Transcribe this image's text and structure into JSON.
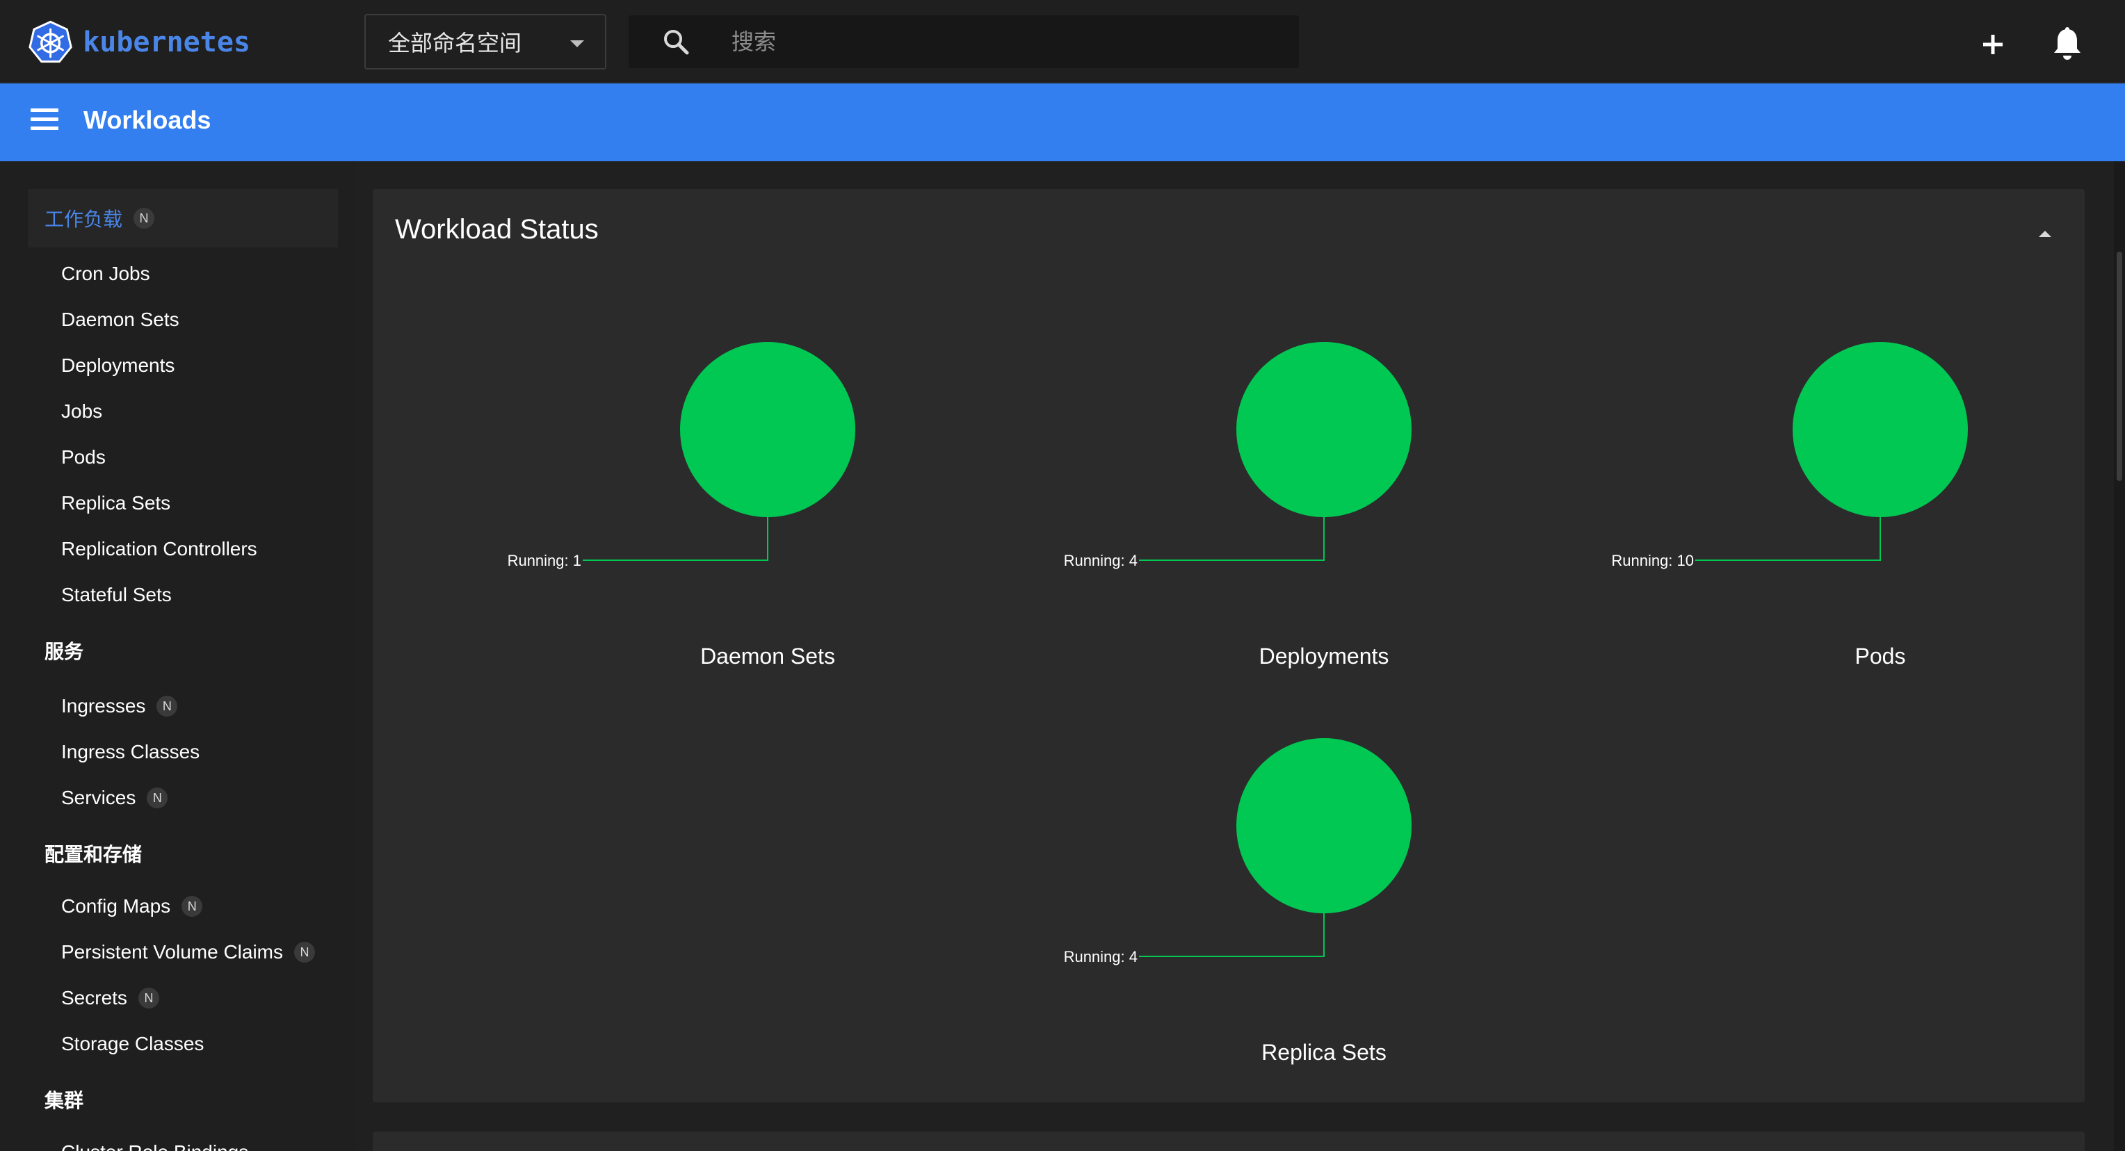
{
  "topbar": {
    "logo_text": "kubernetes",
    "namespace_selected": "全部命名空间",
    "search_placeholder": "搜索",
    "icons": [
      "kubernetes-logo",
      "chevron-down-icon",
      "search-icon",
      "plus-icon",
      "bell-icon"
    ]
  },
  "header": {
    "title": "Workloads"
  },
  "sidebar": {
    "sections": [
      {
        "label": "工作负载",
        "badge": "N",
        "active": true,
        "items": [
          {
            "label": "Cron Jobs"
          },
          {
            "label": "Daemon Sets"
          },
          {
            "label": "Deployments"
          },
          {
            "label": "Jobs"
          },
          {
            "label": "Pods"
          },
          {
            "label": "Replica Sets"
          },
          {
            "label": "Replication Controllers"
          },
          {
            "label": "Stateful Sets"
          }
        ]
      },
      {
        "label": "服务",
        "items": [
          {
            "label": "Ingresses",
            "badge": "N"
          },
          {
            "label": "Ingress Classes"
          },
          {
            "label": "Services",
            "badge": "N"
          }
        ]
      },
      {
        "label": "配置和存储",
        "items": [
          {
            "label": "Config Maps",
            "badge": "N"
          },
          {
            "label": "Persistent Volume Claims",
            "badge": "N"
          },
          {
            "label": "Secrets",
            "badge": "N"
          },
          {
            "label": "Storage Classes"
          }
        ]
      },
      {
        "label": "集群",
        "items": [
          {
            "label": "Cluster Role Bindings"
          }
        ]
      }
    ]
  },
  "workload_status": {
    "title": "Workload Status",
    "running_color": "#00c853",
    "charts": [
      {
        "name": "Daemon Sets",
        "running_label": "Running: 1",
        "running": 1
      },
      {
        "name": "Deployments",
        "running_label": "Running: 4",
        "running": 4
      },
      {
        "name": "Pods",
        "running_label": "Running: 10",
        "running": 10
      },
      {
        "name": "Replica Sets",
        "running_label": "Running: 4",
        "running": 4
      }
    ]
  },
  "chart_data": [
    {
      "type": "pie",
      "title": "Daemon Sets",
      "categories": [
        "Running"
      ],
      "values": [
        1
      ]
    },
    {
      "type": "pie",
      "title": "Deployments",
      "categories": [
        "Running"
      ],
      "values": [
        4
      ]
    },
    {
      "type": "pie",
      "title": "Pods",
      "categories": [
        "Running"
      ],
      "values": [
        10
      ]
    },
    {
      "type": "pie",
      "title": "Replica Sets",
      "categories": [
        "Running"
      ],
      "values": [
        4
      ]
    }
  ]
}
